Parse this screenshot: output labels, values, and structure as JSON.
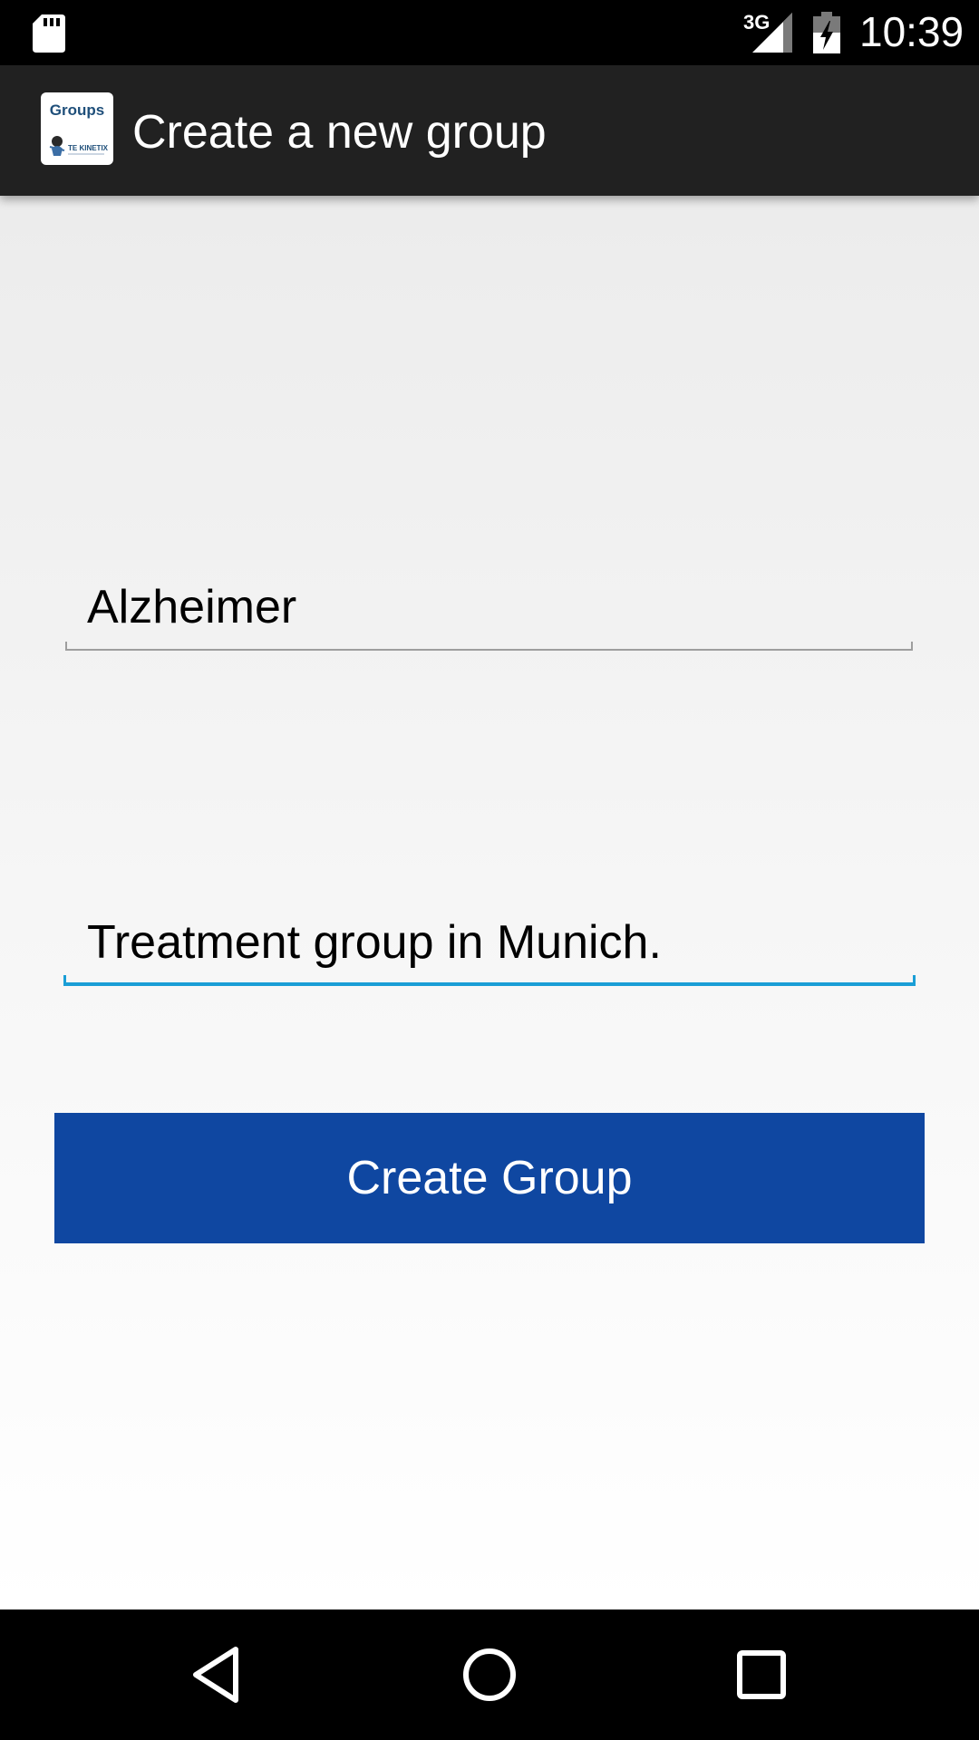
{
  "status_bar": {
    "network_type": "3G",
    "time": "10:39",
    "icons": [
      "sd-card-icon",
      "signal-icon",
      "battery-charging-icon"
    ]
  },
  "action_bar": {
    "app_logo_text": "Groups",
    "app_logo_subtext": "TE KINETIX",
    "title": "Create a new group"
  },
  "form": {
    "group_name_value": "Alzheimer",
    "group_description_value": "Treatment group in Munich.",
    "create_button_label": "Create Group"
  },
  "nav_bar": {
    "icons": [
      "back-icon",
      "home-icon",
      "recents-icon"
    ]
  },
  "colors": {
    "status_bar": "#000000",
    "action_bar": "#212121",
    "button": "#0f47a1",
    "focused_underline": "#1a9ed6",
    "unfocused_underline": "#9e9e9e"
  }
}
